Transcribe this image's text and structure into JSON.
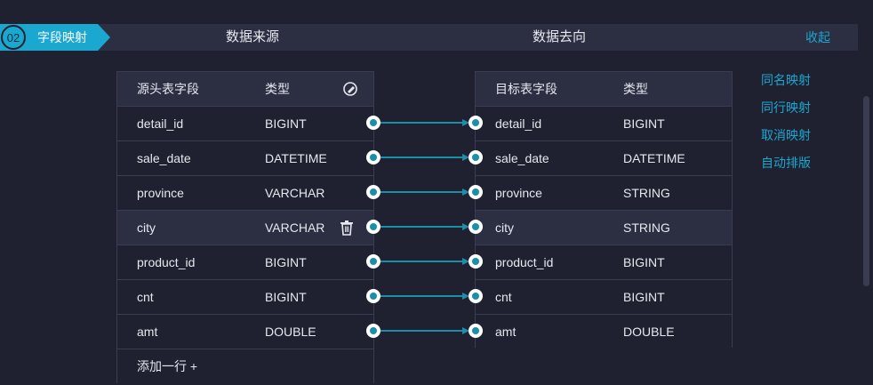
{
  "step": {
    "number": "02",
    "label": "字段映射"
  },
  "header": {
    "source_title": "数据来源",
    "target_title": "数据去向",
    "collapse": "收起"
  },
  "source_table": {
    "headers": [
      "源头表字段",
      "类型"
    ],
    "rows": [
      {
        "field": "detail_id",
        "type": "BIGINT"
      },
      {
        "field": "sale_date",
        "type": "DATETIME"
      },
      {
        "field": "province",
        "type": "VARCHAR"
      },
      {
        "field": "city",
        "type": "VARCHAR"
      },
      {
        "field": "product_id",
        "type": "BIGINT"
      },
      {
        "field": "cnt",
        "type": "BIGINT"
      },
      {
        "field": "amt",
        "type": "DOUBLE"
      }
    ],
    "add_row": "添加一行 +"
  },
  "target_table": {
    "headers": [
      "目标表字段",
      "类型"
    ],
    "rows": [
      {
        "field": "detail_id",
        "type": "BIGINT"
      },
      {
        "field": "sale_date",
        "type": "DATETIME"
      },
      {
        "field": "province",
        "type": "STRING"
      },
      {
        "field": "city",
        "type": "STRING"
      },
      {
        "field": "product_id",
        "type": "BIGINT"
      },
      {
        "field": "cnt",
        "type": "BIGINT"
      },
      {
        "field": "amt",
        "type": "DOUBLE"
      }
    ]
  },
  "actions": [
    "同名映射",
    "同行映射",
    "取消映射",
    "自动排版"
  ],
  "colors": {
    "accent": "#1aa8d0",
    "line": "#1b8fa8",
    "background": "#1f2130",
    "panel": "#2c2f42"
  }
}
